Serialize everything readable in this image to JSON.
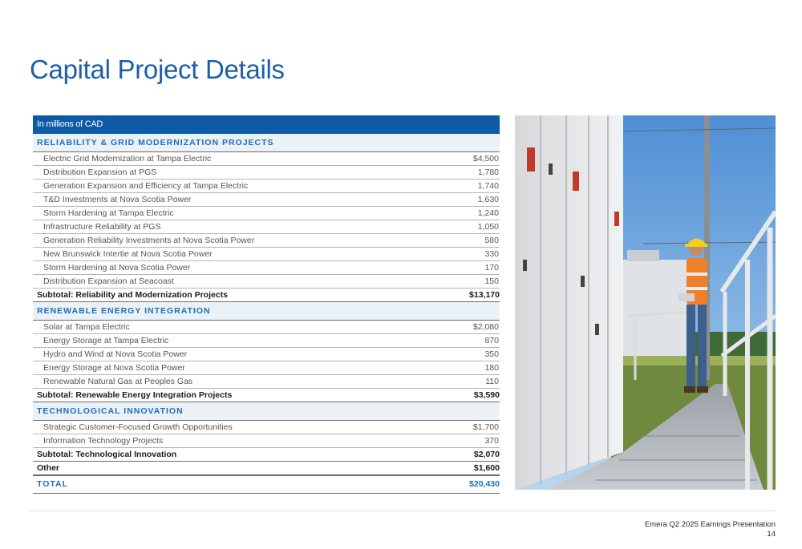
{
  "title": "Capital Project Details",
  "table": {
    "header": "In millions of CAD",
    "sections": [
      {
        "heading": "RELIABILITY & GRID MODERNIZATION PROJECTS",
        "rows": [
          {
            "label": "Electric Grid Modernization at Tampa Electric",
            "value": "$4,500"
          },
          {
            "label": "Distribution Expansion at PGS",
            "value": "1,780"
          },
          {
            "label": "Generation Expansion and Efficiency at Tampa Electric",
            "value": "1,740"
          },
          {
            "label": "T&D Investments at Nova Scotia Power",
            "value": "1,630"
          },
          {
            "label": "Storm Hardening at Tampa Electric",
            "value": "1,240"
          },
          {
            "label": "Infrastructure Reliability at PGS",
            "value": "1,050"
          },
          {
            "label": "Generation Reliability Investments at Nova Scotia Power",
            "value": "580"
          },
          {
            "label": "New Brunswick Intertie at Nova Scotia Power",
            "value": "330"
          },
          {
            "label": "Storm Hardening at Nova Scotia Power",
            "value": "170"
          },
          {
            "label": "Distribution Expansion at Seacoast",
            "value": "150"
          }
        ],
        "subtotal": {
          "label": "Subtotal: Reliability and Modernization Projects",
          "value": "$13,170"
        }
      },
      {
        "heading": "RENEWABLE ENERGY INTEGRATION",
        "rows": [
          {
            "label": "Solar at Tampa Electric",
            "value": "$2,080"
          },
          {
            "label": "Energy Storage at Tampa Electric",
            "value": "870"
          },
          {
            "label": "Hydro and Wind at Nova Scotia Power",
            "value": "350"
          },
          {
            "label": "Energy Storage at Nova Scotia Power",
            "value": "180"
          },
          {
            "label": "Renewable Natural Gas at Peoples Gas",
            "value": "110"
          }
        ],
        "subtotal": {
          "label": "Subtotal: Renewable Energy Integration Projects",
          "value": "$3,590"
        }
      },
      {
        "heading": "TECHNOLOGICAL INNOVATION",
        "rows": [
          {
            "label": "Strategic Customer-Focused Growth Opportunities",
            "value": "$1,700"
          },
          {
            "label": "Information Technology Projects",
            "value": "370"
          }
        ],
        "subtotal": {
          "label": "Subtotal: Technological Innovation",
          "value": "$2,070"
        }
      }
    ],
    "other": {
      "label": "Other",
      "value": "$1,600"
    },
    "total": {
      "label": "TOTAL",
      "value": "$20,430"
    }
  },
  "footer": {
    "presentation": "Emera Q2 2025 Earnings Presentation",
    "page_number": "14"
  },
  "colors": {
    "title": "#1f5fa8",
    "header_bg": "#0d5aa7",
    "section_text": "#1d6eb8",
    "section_bg": "#eaf2f8"
  }
}
